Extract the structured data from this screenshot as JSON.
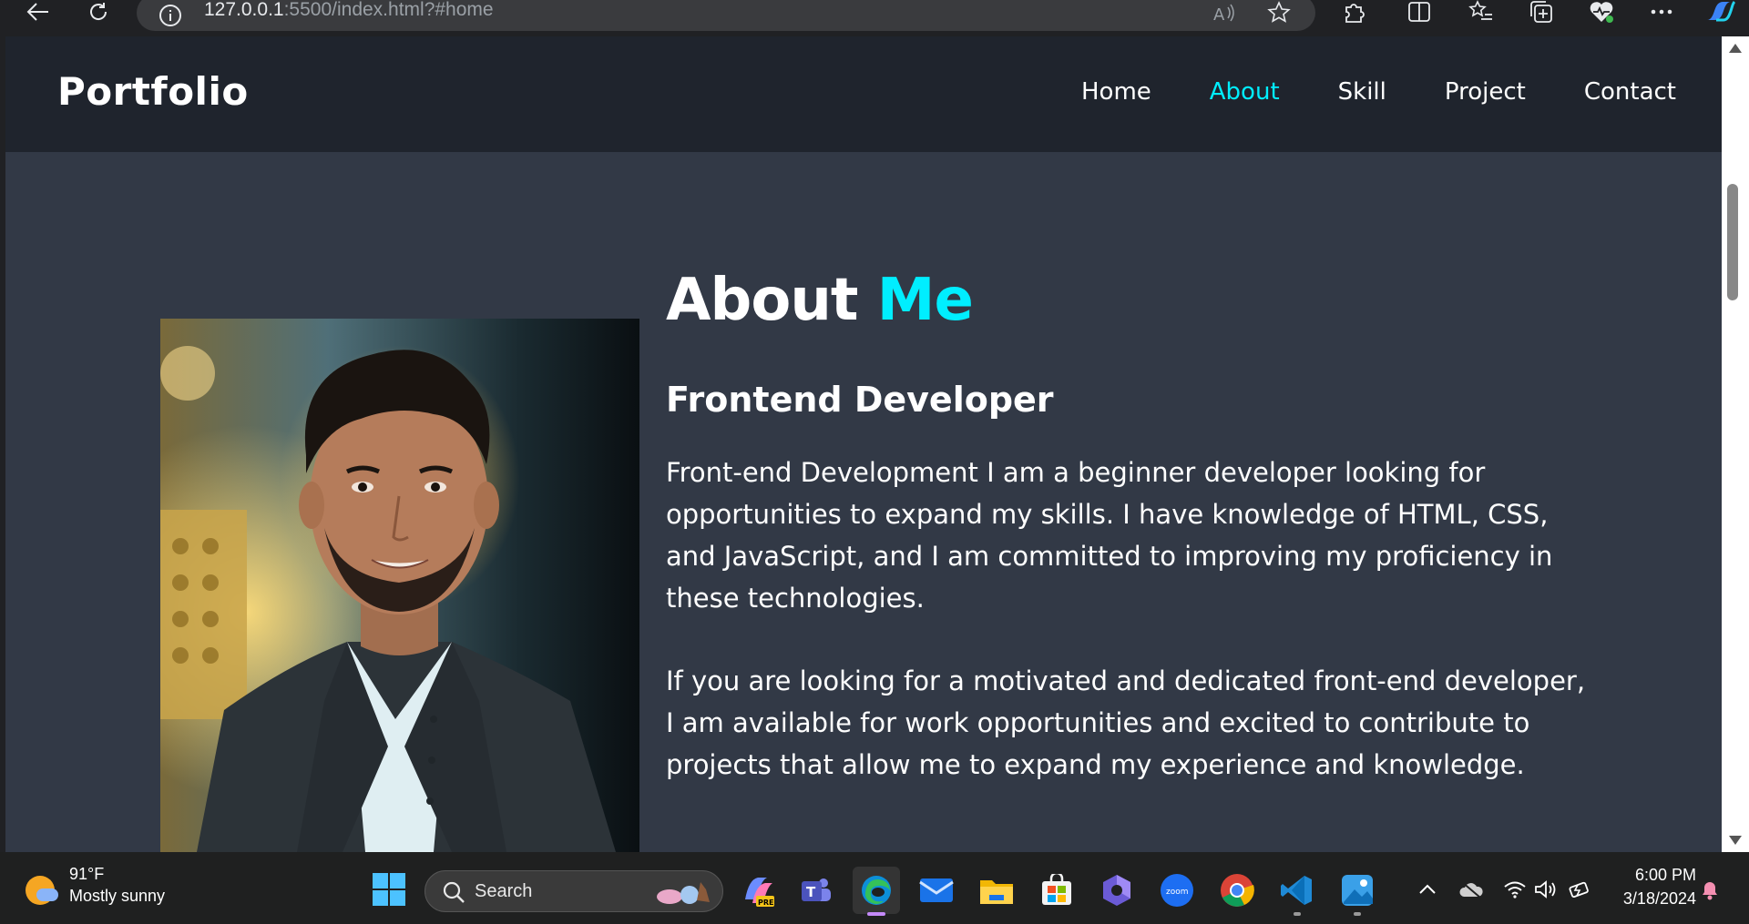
{
  "browser": {
    "url_host": "127.0.0.1",
    "url_rest": ":5500/index.html?#home"
  },
  "site": {
    "logo": "Portfolio",
    "nav": [
      {
        "label": "Home",
        "active": false
      },
      {
        "label": "About",
        "active": true
      },
      {
        "label": "Skill",
        "active": false
      },
      {
        "label": "Project",
        "active": false
      },
      {
        "label": "Contact",
        "active": false
      }
    ],
    "accent_color": "#00eeff"
  },
  "about": {
    "title_part1": "About ",
    "title_part2": "Me",
    "subtitle": "Frontend Developer",
    "paragraph1": "Front-end Development I am a beginner developer looking for opportunities to expand my skills. I have knowledge of HTML, CSS, and JavaScript, and I am committed to improving my proficiency in these technologies.",
    "paragraph2": "If you are looking for a motivated and dedicated front-end developer, I am available for work opportunities and excited to contribute to projects that allow me to expand my experience and knowledge."
  },
  "taskbar": {
    "weather_temp": "91°F",
    "weather_condition": "Mostly sunny",
    "search_label": "Search",
    "time": "6:00 PM",
    "date": "3/18/2024"
  }
}
